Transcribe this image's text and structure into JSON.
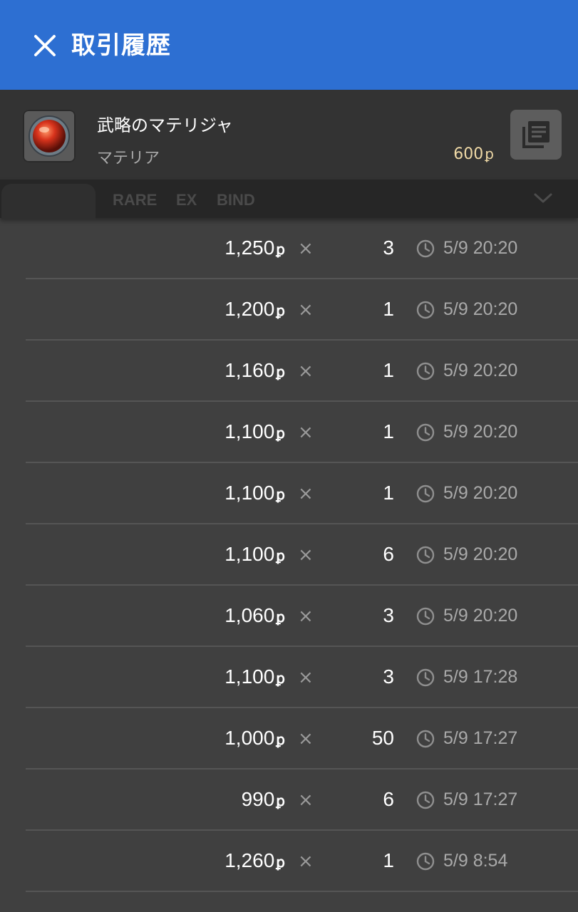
{
  "header": {
    "title": "取引履歴"
  },
  "item": {
    "name": "武略のマテリジャ",
    "category": "マテリア",
    "price": "600",
    "currency": "ꝑ"
  },
  "filters": [
    "RARE",
    "EX",
    "BIND"
  ],
  "history": [
    {
      "price": "1,250",
      "qty": "3",
      "time": "5/9 20:20"
    },
    {
      "price": "1,200",
      "qty": "1",
      "time": "5/9 20:20"
    },
    {
      "price": "1,160",
      "qty": "1",
      "time": "5/9 20:20"
    },
    {
      "price": "1,100",
      "qty": "1",
      "time": "5/9 20:20"
    },
    {
      "price": "1,100",
      "qty": "1",
      "time": "5/9 20:20"
    },
    {
      "price": "1,100",
      "qty": "6",
      "time": "5/9 20:20"
    },
    {
      "price": "1,060",
      "qty": "3",
      "time": "5/9 20:20"
    },
    {
      "price": "1,100",
      "qty": "3",
      "time": "5/9 17:28"
    },
    {
      "price": "1,000",
      "qty": "50",
      "time": "5/9 17:27"
    },
    {
      "price": "990",
      "qty": "6",
      "time": "5/9 17:27"
    },
    {
      "price": "1,260",
      "qty": "1",
      "time": "5/9 8:54"
    }
  ],
  "symbols": {
    "times": "×"
  },
  "icons": {
    "close": "close-icon",
    "detail": "document-list-icon",
    "chevron": "chevron-down-icon",
    "clock": "clock-icon",
    "item": "materia-orb-icon"
  },
  "colors": {
    "header": "#2d6fd2",
    "background": "#404040",
    "price_accent": "#efd9a6"
  }
}
